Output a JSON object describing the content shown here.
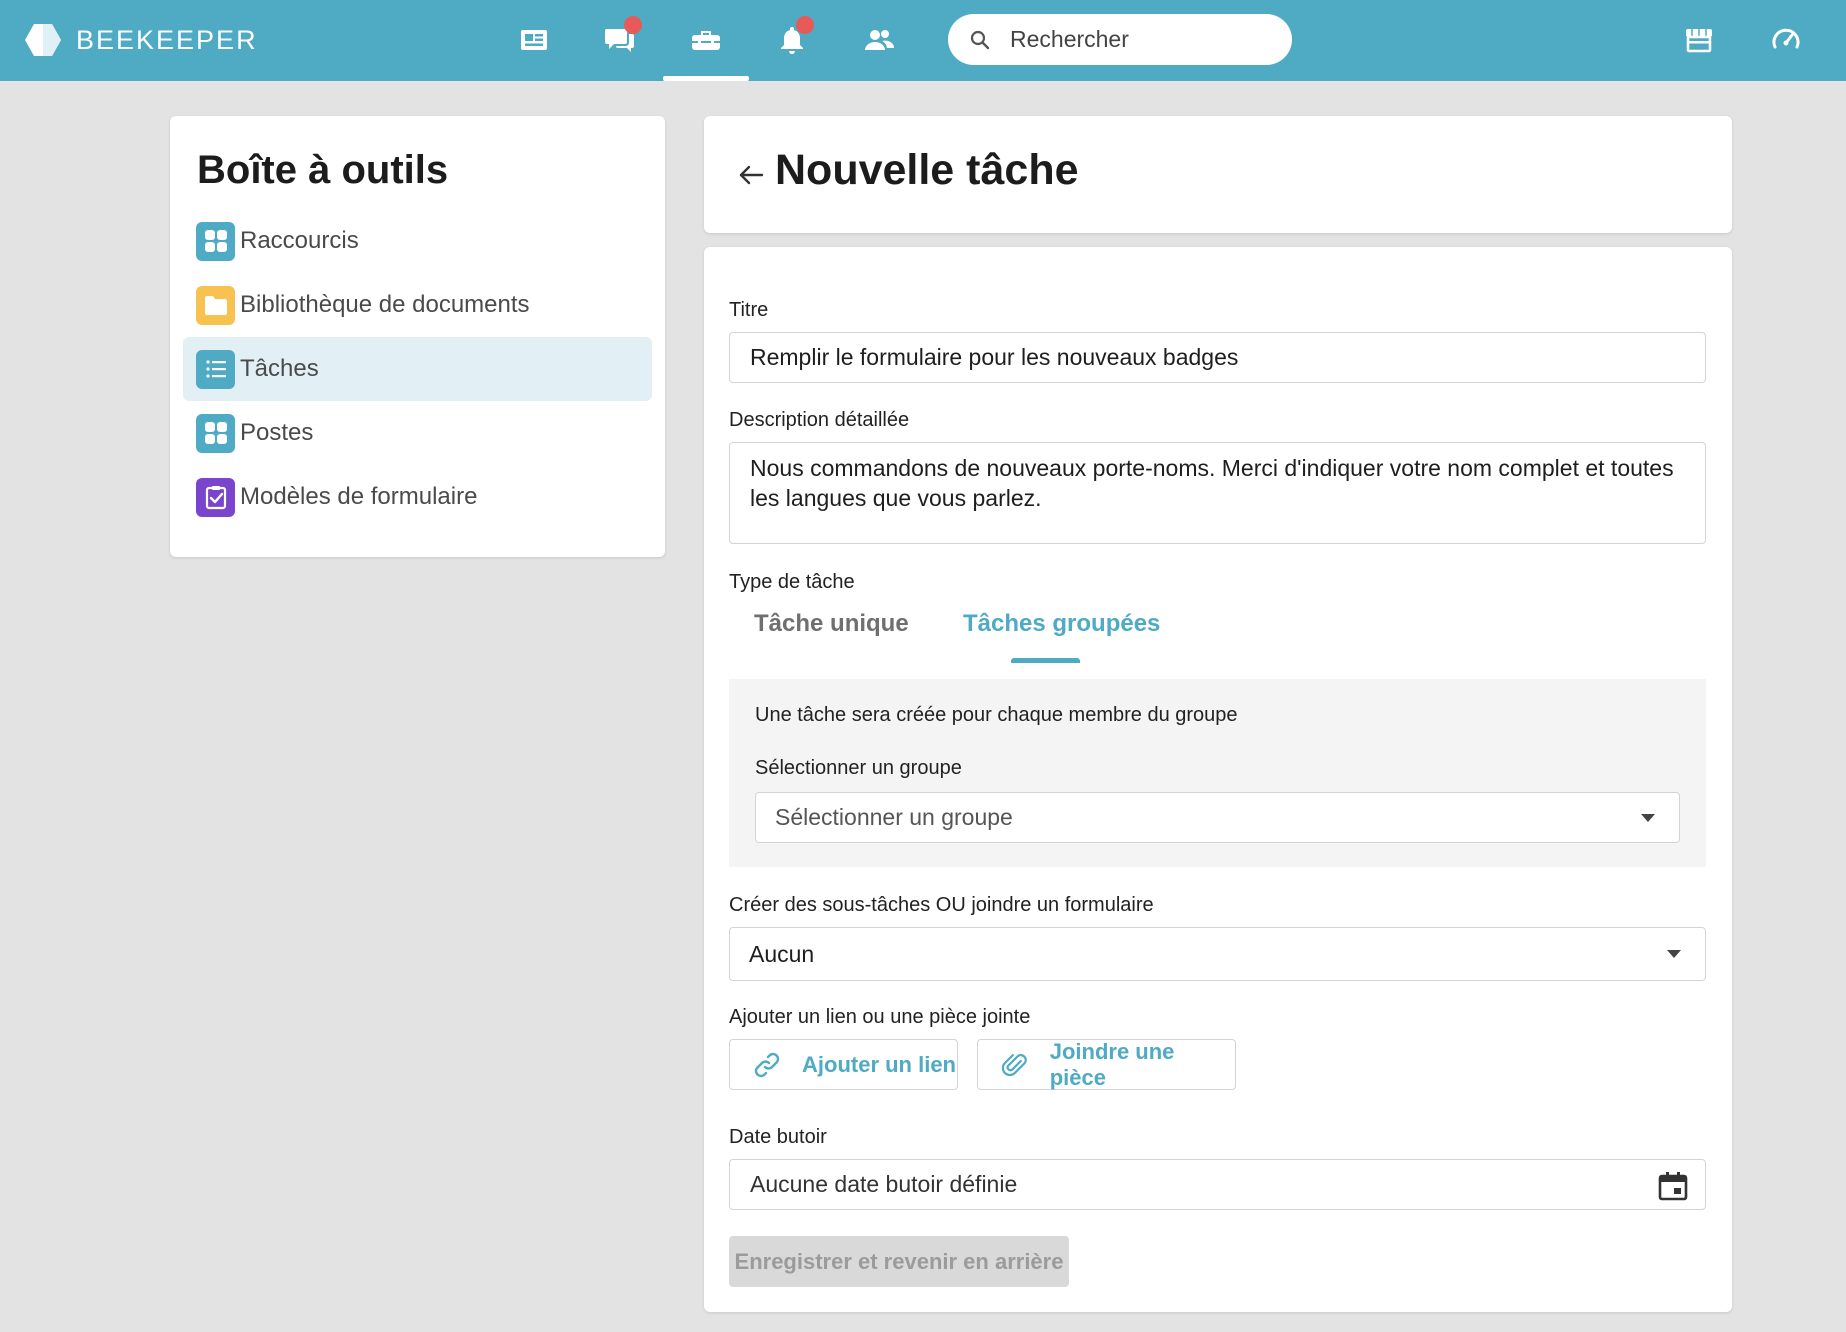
{
  "topbar": {
    "logo_text": "BEEKEEPER",
    "search_placeholder": "Rechercher",
    "bg_color": "#4faac4",
    "nav_icons": [
      "news-feed-icon",
      "chat-icon",
      "toolbox-icon",
      "bell-icon",
      "people-icon"
    ],
    "active_nav": "toolbox-icon",
    "right_icons": [
      "marketplace-icon",
      "dashboard-gauge-icon"
    ]
  },
  "sidebar": {
    "title": "Boîte à outils",
    "items": [
      {
        "label": "Raccourcis",
        "icon": "grid-icon",
        "color": "#4faac4"
      },
      {
        "label": "Bibliothèque de documents",
        "icon": "folder-icon",
        "color": "#f7c24f"
      },
      {
        "label": "Tâches",
        "icon": "list-icon",
        "color": "#4faac4",
        "active": true
      },
      {
        "label": "Postes",
        "icon": "grid-icon",
        "color": "#4faac4"
      },
      {
        "label": "Modèles de formulaire",
        "icon": "clipboard-check-icon",
        "color": "#7b44cc"
      }
    ]
  },
  "header": {
    "title": "Nouvelle tâche"
  },
  "form": {
    "title_label": "Titre",
    "title_value": "Remplir le formulaire pour les nouveaux badges",
    "description_label": "Description détaillée",
    "description_value": "Nous commandons de nouveaux porte-noms. Merci d'indiquer votre nom complet et toutes les langues que vous parlez.",
    "type_label": "Type de tâche",
    "tabs": [
      {
        "label": "Tâche unique",
        "active": false
      },
      {
        "label": "Tâches groupées",
        "active": true
      }
    ],
    "group_info": "Une tâche sera créée pour chaque membre du groupe",
    "group_select_label": "Sélectionner un groupe",
    "group_select_placeholder": "Sélectionner un groupe",
    "subtasks_label": "Créer des sous-tâches OU joindre un formulaire",
    "subtasks_value": "Aucun",
    "attachments_label": "Ajouter un lien ou une pièce jointe",
    "add_link_label": "Ajouter un lien",
    "attach_file_label": "Joindre une pièce",
    "due_date_label": "Date butoir",
    "due_date_value": "Aucune date butoir définie",
    "save_label": "Enregistrer et revenir en arrière"
  },
  "colors": {
    "accent": "#4faac4",
    "notification": "#e85a5a",
    "folder": "#f7c24f",
    "forms": "#7b44cc"
  }
}
